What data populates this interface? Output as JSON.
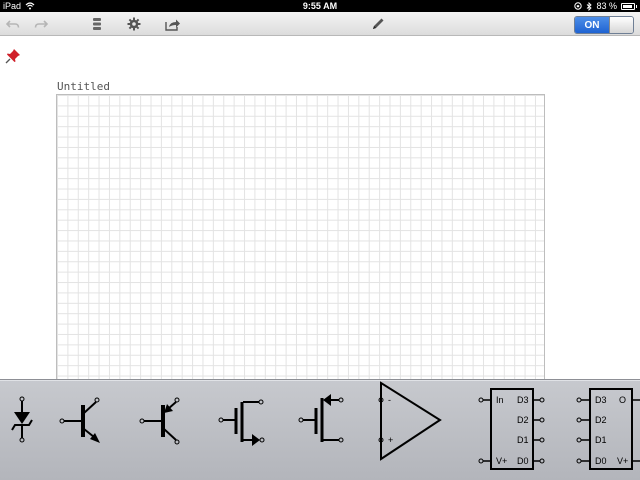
{
  "status_bar": {
    "device": "iPad",
    "time": "9:55 AM",
    "battery": "83 %"
  },
  "toolbar": {
    "buttons": [
      "undo-icon",
      "redo-icon",
      "library-icon",
      "gear-icon",
      "share-icon",
      "pencil-icon"
    ],
    "toggle_label": "ON"
  },
  "canvas": {
    "title": "Untitled"
  },
  "palette": {
    "components": [
      {
        "name": "zener-diode-icon"
      },
      {
        "name": "npn-transistor-icon"
      },
      {
        "name": "pnp-transistor-icon"
      },
      {
        "name": "n-mosfet-icon"
      },
      {
        "name": "p-mosfet-icon"
      },
      {
        "name": "op-amp-icon",
        "labels": {
          "minus": "-",
          "plus": "+"
        }
      },
      {
        "name": "shift-register-icon",
        "labels": {
          "in": "In",
          "d3": "D3",
          "d2": "D2",
          "d1": "D1",
          "vplus": "V+",
          "d0": "D0"
        }
      },
      {
        "name": "dac-icon",
        "labels": {
          "d3": "D3",
          "o": "O",
          "d2": "D2",
          "d1": "D1",
          "d0": "D0",
          "vplus": "V+"
        }
      }
    ]
  },
  "colors": {
    "accent": "#1f63d2",
    "pin": "#d0202a",
    "palette_bg": "#c0c2c7"
  }
}
